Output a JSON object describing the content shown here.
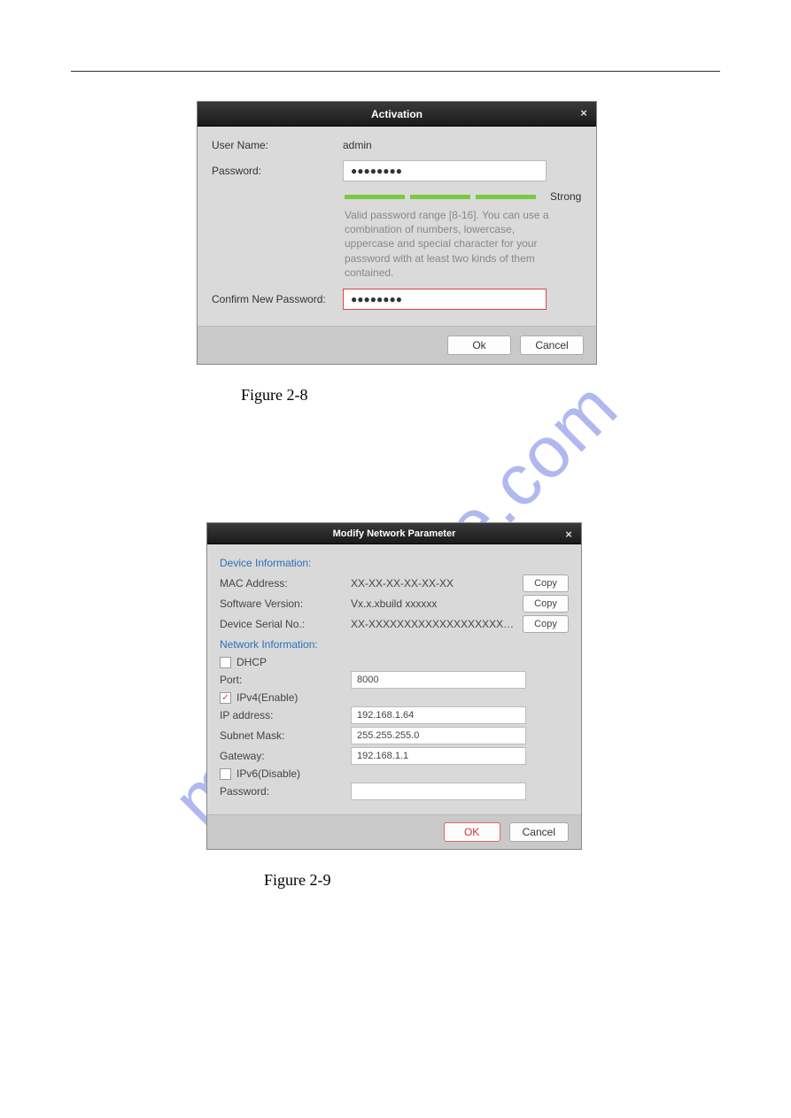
{
  "watermark": "manualshive.com",
  "fig28": {
    "title": "Activation",
    "close": "×",
    "usernameLabel": "User Name:",
    "usernameValue": "admin",
    "passwordLabel": "Password:",
    "passwordValue": "●●●●●●●●",
    "strengthLabel": "Strong",
    "hint": "Valid password range [8-16]. You can use a combination of numbers, lowercase, uppercase and special character for your password with at least two kinds of them contained.",
    "confirmLabel": "Confirm New Password:",
    "confirmValue": "●●●●●●●●",
    "okLabel": "Ok",
    "cancelLabel": "Cancel",
    "caption": "Figure 2-8"
  },
  "fig29": {
    "title": "Modify Network Parameter",
    "close": "×",
    "sectDeviceInfo": "Device Information:",
    "macLabel": "MAC Address:",
    "macValue": "XX-XX-XX-XX-XX-XX",
    "swLabel": "Software Version:",
    "swValue": "Vx.x.xbuild xxxxxx",
    "serialLabel": "Device Serial No.:",
    "serialValue": "XX-XXXXXXXXXXXXXXXXXXXXXXXXXXXXXXX",
    "copyLabel": "Copy",
    "sectNetInfo": "Network Information:",
    "dhcpLabel": "DHCP",
    "dhcpChecked": false,
    "portLabel": "Port:",
    "portValue": "8000",
    "ipv4Label": "IPv4(Enable)",
    "ipv4Checked": true,
    "ipLabel": "IP address:",
    "ipValue": "192.168.1.64",
    "maskLabel": "Subnet Mask:",
    "maskValue": "255.255.255.0",
    "gwLabel": "Gateway:",
    "gwValue": "192.168.1.1",
    "ipv6Label": "IPv6(Disable)",
    "ipv6Checked": false,
    "pwdLabel": "Password:",
    "pwdValue": "",
    "okLabel": "OK",
    "cancelLabel": "Cancel",
    "caption": "Figure 2-9"
  }
}
